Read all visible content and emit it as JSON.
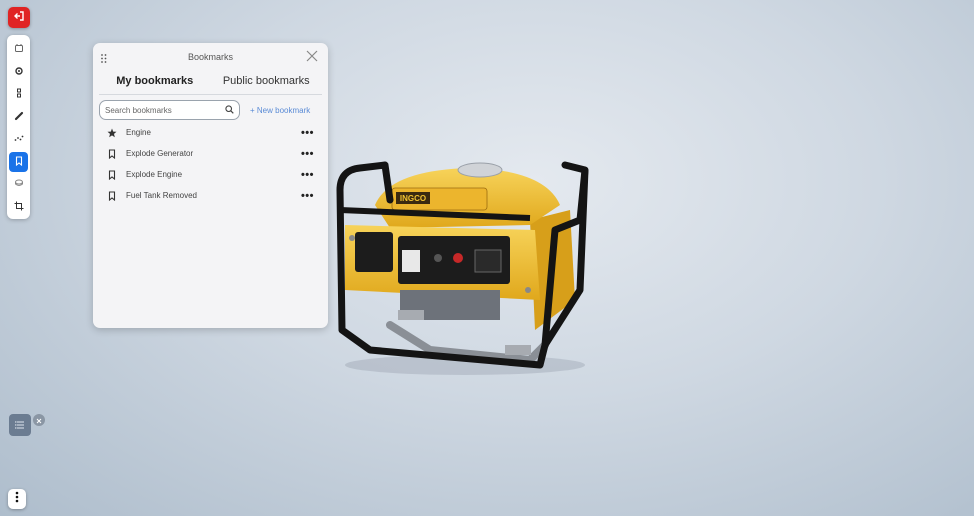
{
  "icons": {
    "exit": "exit-icon",
    "tools": [
      "home-icon",
      "settings-icon",
      "model-tree-icon",
      "measure-icon",
      "explode-icon",
      "bookmark-icon",
      "section-icon",
      "crop-icon"
    ],
    "drag": "drag-handle-icon",
    "close": "close-icon",
    "search": "search-icon",
    "more": "more-vertical-icon"
  },
  "colors": {
    "exit_button": "#e02424",
    "active_tool": "#1a73e8",
    "new_bookmark_link": "#5a8bd6",
    "generator_body": "#f2c230"
  },
  "panel": {
    "title": "Bookmarks",
    "tabs": [
      {
        "label": "My bookmarks",
        "active": true
      },
      {
        "label": "Public bookmarks",
        "active": false
      }
    ],
    "search": {
      "placeholder": "Search bookmarks",
      "value": ""
    },
    "new_bookmark": "+ New bookmark",
    "items": [
      {
        "label": "Engine",
        "icon": "star-icon"
      },
      {
        "label": "Explode Generator",
        "icon": "bookmark-icon"
      },
      {
        "label": "Explode Engine",
        "icon": "bookmark-icon"
      },
      {
        "label": "Fuel Tank Removed",
        "icon": "bookmark-icon"
      }
    ],
    "item_menu": "•••"
  },
  "viewport": {
    "model_brand": "INGCO"
  }
}
